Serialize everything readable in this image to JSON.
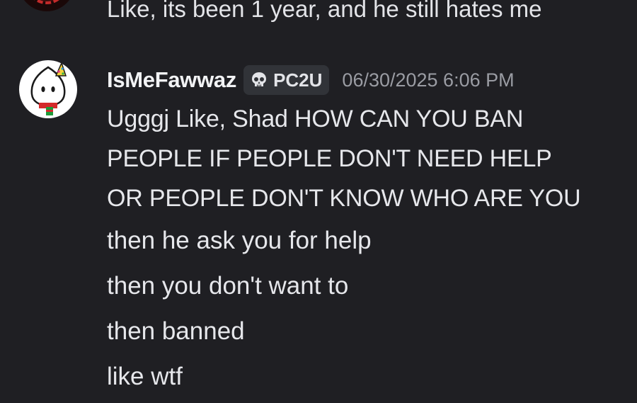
{
  "previous_message": {
    "text": "Like, its been 1 year, and he still hates me"
  },
  "message": {
    "username": "IsMeFawwaz",
    "tag": {
      "icon": "skull-icon",
      "label": "PC2U"
    },
    "timestamp": "06/30/2025 6:06 PM",
    "lines": [
      "Ugggj Like, Shad HOW CAN YOU BAN",
      "PEOPLE IF PEOPLE DON'T NEED HELP",
      "OR PEOPLE DON'T KNOW WHO ARE YOU",
      "then he ask you for help",
      "then you don't want to",
      "then banned",
      "like wtf"
    ]
  },
  "colors": {
    "background": "#1f1f23",
    "username": "#f2f3f5",
    "timestamp": "#9a9ca3",
    "tag_background": "#313338",
    "text": "#e6e7eb"
  }
}
